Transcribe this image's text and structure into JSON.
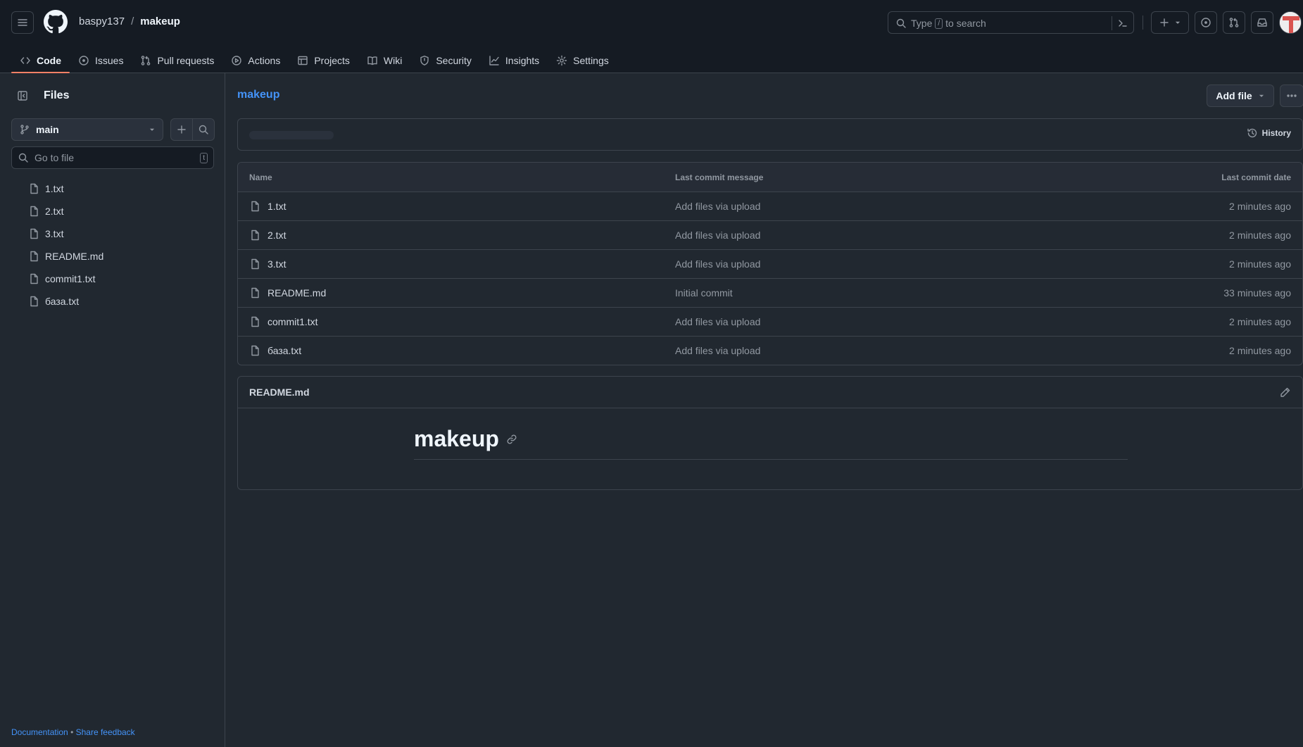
{
  "header": {
    "owner": "baspy137",
    "separator": "/",
    "repo": "makeup",
    "search_prefix": "Type",
    "search_key": "/",
    "search_suffix": "to search"
  },
  "nav": [
    {
      "label": "Code",
      "icon": "code-icon",
      "active": true
    },
    {
      "label": "Issues",
      "icon": "issue-icon"
    },
    {
      "label": "Pull requests",
      "icon": "pull-request-icon"
    },
    {
      "label": "Actions",
      "icon": "play-icon"
    },
    {
      "label": "Projects",
      "icon": "table-icon"
    },
    {
      "label": "Wiki",
      "icon": "book-icon"
    },
    {
      "label": "Security",
      "icon": "shield-icon"
    },
    {
      "label": "Insights",
      "icon": "graph-icon"
    },
    {
      "label": "Settings",
      "icon": "gear-icon"
    }
  ],
  "sidebar": {
    "title": "Files",
    "branch": "main",
    "goto_placeholder": "Go to file",
    "goto_key": "t",
    "files": [
      "1.txt",
      "2.txt",
      "3.txt",
      "README.md",
      "commit1.txt",
      "база.txt"
    ],
    "footer_doc": "Documentation",
    "footer_sep": "•",
    "footer_feedback": "Share feedback"
  },
  "main": {
    "repo_link": "makeup",
    "add_file": "Add file",
    "history": "History",
    "table": {
      "headers": {
        "name": "Name",
        "message": "Last commit message",
        "date": "Last commit date"
      },
      "rows": [
        {
          "name": "1.txt",
          "message": "Add files via upload",
          "date": "2 minutes ago"
        },
        {
          "name": "2.txt",
          "message": "Add files via upload",
          "date": "2 minutes ago"
        },
        {
          "name": "3.txt",
          "message": "Add files via upload",
          "date": "2 minutes ago"
        },
        {
          "name": "README.md",
          "message": "Initial commit",
          "date": "33 minutes ago"
        },
        {
          "name": "commit1.txt",
          "message": "Add files via upload",
          "date": "2 minutes ago"
        },
        {
          "name": "база.txt",
          "message": "Add files via upload",
          "date": "2 minutes ago"
        }
      ]
    },
    "readme": {
      "title": "README.md",
      "heading": "makeup"
    }
  },
  "colors": {
    "accent": "#4493f8",
    "active_underline": "#f78166",
    "background": "#212830"
  }
}
